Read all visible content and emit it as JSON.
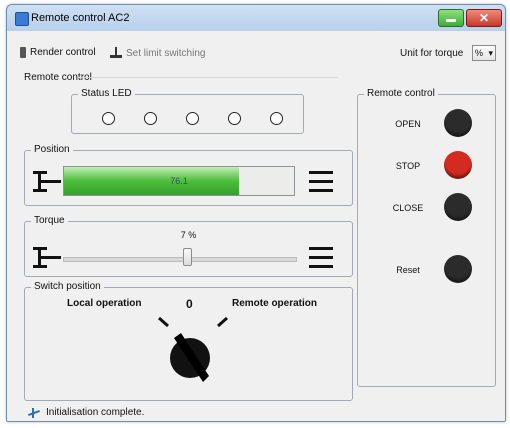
{
  "window": {
    "title": "Remote control AC2"
  },
  "toolbar": {
    "render_control": "Render control",
    "set_limit_switching": "Set limit switching",
    "unit_label": "Unit for torque",
    "unit_value": "%"
  },
  "section_title": "Remote control",
  "status_led": {
    "title": "Status LED",
    "count": 5
  },
  "position": {
    "title": "Position",
    "value_text": "76.1",
    "fraction": 0.761
  },
  "torque": {
    "title": "Torque",
    "value_text": "7 %",
    "fraction": 0.07
  },
  "switch_position": {
    "title": "Switch position",
    "local_label": "Local operation",
    "center_value": "0",
    "remote_label": "Remote operation"
  },
  "remote_panel": {
    "title": "Remote control",
    "buttons": [
      {
        "label": "OPEN",
        "color": "#2b2b2b"
      },
      {
        "label": "STOP",
        "color": "#d42b20"
      },
      {
        "label": "CLOSE",
        "color": "#2b2b2b"
      },
      {
        "label": "Reset",
        "color": "#2b2b2b"
      }
    ]
  },
  "status_bar": {
    "text": "Initialisation complete."
  }
}
